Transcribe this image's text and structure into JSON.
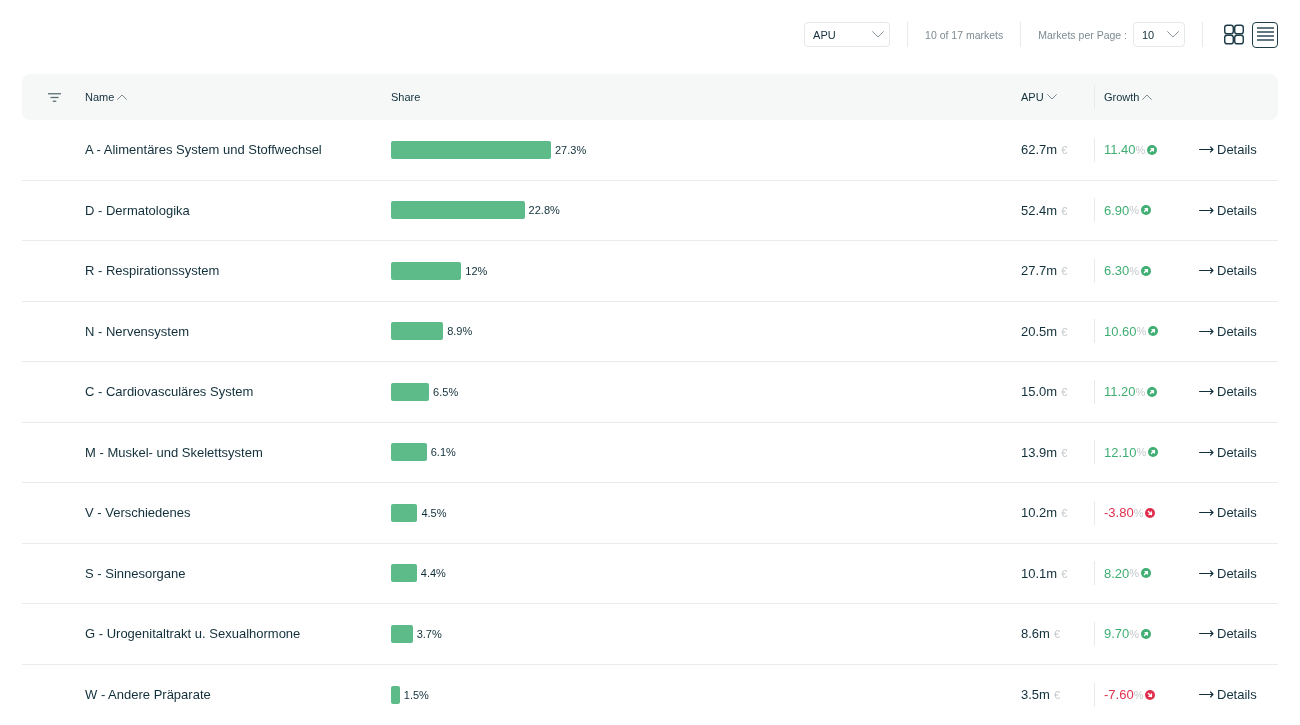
{
  "toolbar": {
    "metric_select": {
      "value": "APU"
    },
    "count_label": "10 of 17 markets",
    "per_page": {
      "label": "Markets per Page :",
      "value": "10"
    },
    "view_options": [
      {
        "kind": "grid",
        "selected": false
      },
      {
        "kind": "list",
        "selected": true
      }
    ]
  },
  "table": {
    "columns": [
      {
        "label": "Name",
        "sort_up": true,
        "sort_down": false
      },
      {
        "label": "Share",
        "sort_up": false,
        "sort_down": false
      },
      {
        "label": "APU",
        "sort_up": false,
        "sort_down": true
      },
      {
        "label": "Growth",
        "sort_up": true,
        "sort_down": false
      }
    ],
    "rows": [
      {
        "name": "A - Alimentäres System und Stoffwechsel",
        "share": "27.3%",
        "level": 0.273,
        "apu": "62.7m",
        "currency": "€",
        "growth": "11.40",
        "growth_unit": "%",
        "rising": true,
        "action": "Details"
      },
      {
        "name": "D - Dermatologika",
        "share": "22.8%",
        "level": 0.228,
        "apu": "52.4m",
        "currency": "€",
        "growth": "6.90",
        "growth_unit": "%",
        "rising": true,
        "action": "Details"
      },
      {
        "name": "R - Respirationssystem",
        "share": "12%",
        "level": 0.12,
        "apu": "27.7m",
        "currency": "€",
        "growth": "6.30",
        "growth_unit": "%",
        "rising": true,
        "action": "Details"
      },
      {
        "name": "N - Nervensystem",
        "share": "8.9%",
        "level": 0.089,
        "apu": "20.5m",
        "currency": "€",
        "growth": "10.60",
        "growth_unit": "%",
        "rising": true,
        "action": "Details"
      },
      {
        "name": "C - Cardiovasculäres System",
        "share": "6.5%",
        "level": 0.065,
        "apu": "15.0m",
        "currency": "€",
        "growth": "11.20",
        "growth_unit": "%",
        "rising": true,
        "action": "Details"
      },
      {
        "name": "M - Muskel- und Skelettsystem",
        "share": "6.1%",
        "level": 0.061,
        "apu": "13.9m",
        "currency": "€",
        "growth": "12.10",
        "growth_unit": "%",
        "rising": true,
        "action": "Details"
      },
      {
        "name": "V - Verschiedenes",
        "share": "4.5%",
        "level": 0.045,
        "apu": "10.2m",
        "currency": "€",
        "growth": "-3.80",
        "growth_unit": "%",
        "rising": false,
        "action": "Details"
      },
      {
        "name": "S - Sinnesorgane",
        "share": "4.4%",
        "level": 0.044,
        "apu": "10.1m",
        "currency": "€",
        "growth": "8.20",
        "growth_unit": "%",
        "rising": true,
        "action": "Details"
      },
      {
        "name": "G - Urogenitaltrakt u. Sexualhormone",
        "share": "3.7%",
        "level": 0.037,
        "apu": "8.6m",
        "currency": "€",
        "growth": "9.70",
        "growth_unit": "%",
        "rising": true,
        "action": "Details"
      },
      {
        "name": "W - Andere Präparate",
        "share": "1.5%",
        "level": 0.015,
        "apu": "3.5m",
        "currency": "€",
        "growth": "-7.60",
        "growth_unit": "%",
        "rising": false,
        "action": "Details"
      }
    ]
  }
}
